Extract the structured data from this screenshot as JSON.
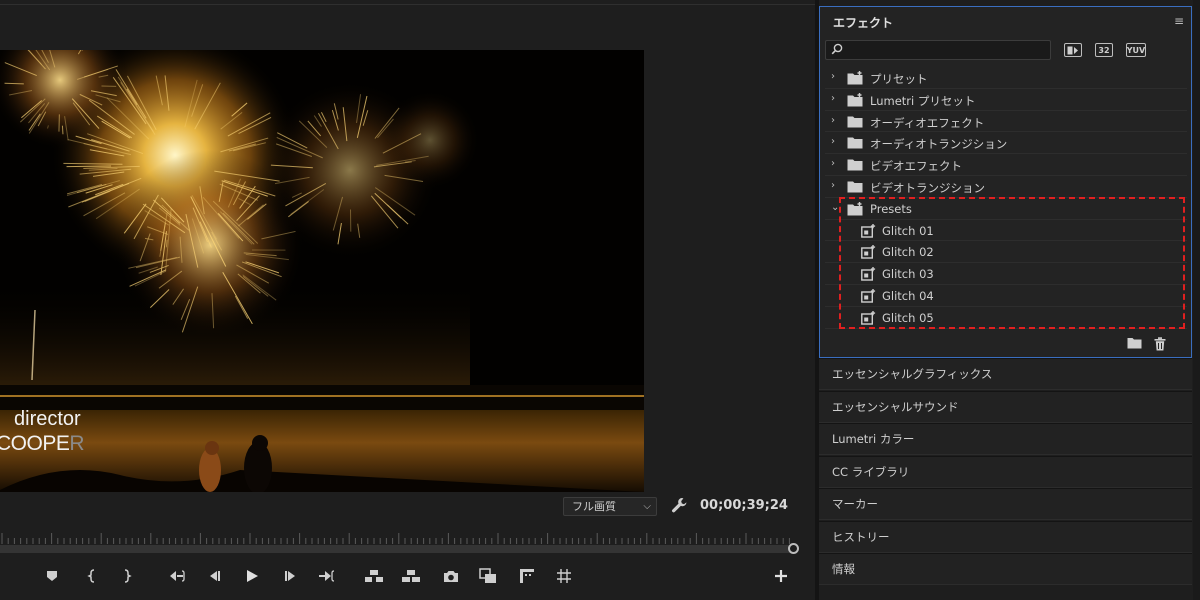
{
  "program_monitor": {
    "video_overlay": {
      "line1": "director",
      "line2_main": "COOPE",
      "line2_fade": "R"
    },
    "playback_resolution": "フル画質",
    "timecode": "00;00;39;24",
    "transport_buttons": [
      {
        "name": "add-marker-button",
        "icon": "marker-icon"
      },
      {
        "name": "mark-in-button",
        "icon": "mark-in-icon"
      },
      {
        "name": "mark-out-button",
        "icon": "mark-out-icon"
      },
      {
        "name": "go-to-in-button",
        "icon": "go-to-in-icon"
      },
      {
        "name": "step-back-button",
        "icon": "step-back-icon"
      },
      {
        "name": "play-button",
        "icon": "play-icon"
      },
      {
        "name": "step-forward-button",
        "icon": "step-forward-icon"
      },
      {
        "name": "go-to-out-button",
        "icon": "go-to-out-icon"
      },
      {
        "name": "lift-button",
        "icon": "lift-icon"
      },
      {
        "name": "extract-button",
        "icon": "extract-icon"
      },
      {
        "name": "export-frame-button",
        "icon": "camera-icon"
      },
      {
        "name": "comparison-view-button",
        "icon": "comparison-icon"
      },
      {
        "name": "safe-margins-button",
        "icon": "safe-margins-icon"
      },
      {
        "name": "grid-button",
        "icon": "grid-icon"
      },
      {
        "name": "button-editor-button",
        "icon": "plus-icon"
      }
    ]
  },
  "effects_panel": {
    "title": "エフェクト",
    "search": {
      "value": "",
      "placeholder": ""
    },
    "filter_badges": [
      "accelerated",
      "32",
      "YUV"
    ],
    "tree": [
      {
        "label": "プリセット",
        "type": "preset-bin",
        "expanded": false
      },
      {
        "label": "Lumetri プリセット",
        "type": "preset-bin",
        "expanded": false
      },
      {
        "label": "オーディオエフェクト",
        "type": "bin",
        "expanded": false
      },
      {
        "label": "オーディオトランジション",
        "type": "bin",
        "expanded": false
      },
      {
        "label": "ビデオエフェクト",
        "type": "bin",
        "expanded": false
      },
      {
        "label": "ビデオトランジション",
        "type": "bin",
        "expanded": false
      },
      {
        "label": "Presets",
        "type": "preset-bin",
        "expanded": true
      },
      {
        "label": "Glitch 01",
        "type": "preset",
        "child": true
      },
      {
        "label": "Glitch 02",
        "type": "preset",
        "child": true
      },
      {
        "label": "Glitch 03",
        "type": "preset",
        "child": true
      },
      {
        "label": "Glitch 04",
        "type": "preset",
        "child": true
      },
      {
        "label": "Glitch 05",
        "type": "preset",
        "child": true
      }
    ],
    "highlight_color": "#e02020",
    "focus_border_color": "#3a6ec0"
  },
  "side_panels": [
    "エッセンシャルグラフィックス",
    "エッセンシャルサウンド",
    "Lumetri カラー",
    "CC ライブラリ",
    "マーカー",
    "ヒストリー",
    "情報"
  ]
}
